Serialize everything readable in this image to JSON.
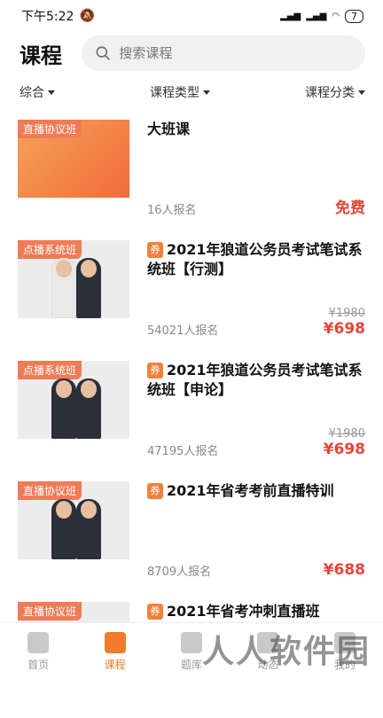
{
  "status": {
    "time": "下午5:22",
    "battery": "7"
  },
  "header": {
    "title": "课程",
    "search_placeholder": "搜索课程"
  },
  "filters": [
    {
      "label": "综合"
    },
    {
      "label": "课程类型"
    },
    {
      "label": "课程分类"
    }
  ],
  "courses": [
    {
      "tag": "直播协议班",
      "title": "大班课",
      "coupon": "",
      "enroll": "16人报名",
      "orig": "",
      "price": "免费"
    },
    {
      "tag": "点播系统班",
      "title": "2021年狼道公务员考试笔试系统班【行测】",
      "coupon": "券",
      "enroll": "54021人报名",
      "orig": "¥1980",
      "price": "¥698"
    },
    {
      "tag": "点播系统班",
      "title": "2021年狼道公务员考试笔试系统班【申论】",
      "coupon": "券",
      "enroll": "47195人报名",
      "orig": "¥1980",
      "price": "¥698"
    },
    {
      "tag": "直播协议班",
      "title": "2021年省考考前直播特训",
      "coupon": "券",
      "enroll": "8709人报名",
      "orig": "",
      "price": "¥688"
    },
    {
      "tag": "直播协议班",
      "title": "2021年省考冲刺直播班",
      "coupon": "券",
      "enroll": "",
      "orig": "",
      "price": ""
    }
  ],
  "tabs": [
    {
      "label": "首页"
    },
    {
      "label": "课程"
    },
    {
      "label": "题库"
    },
    {
      "label": "动态"
    },
    {
      "label": "我的"
    }
  ],
  "watermark": "人人软件园",
  "colors": {
    "accent": "#f07b2a",
    "price": "#e8443a",
    "tag": "#f07b57"
  }
}
